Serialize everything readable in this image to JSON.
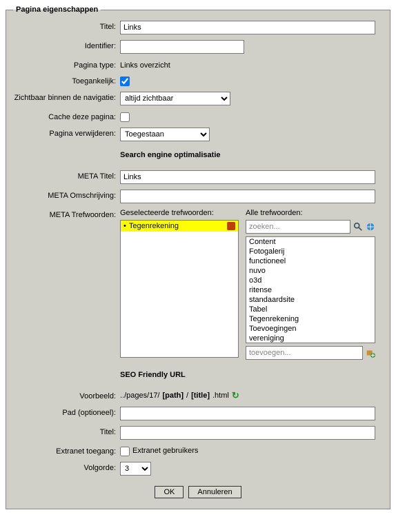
{
  "legend": "Pagina eigenschappen",
  "labels": {
    "titel": "Titel:",
    "identifier": "Identifier:",
    "pagina_type": "Pagina type:",
    "toegankelijk": "Toegankelijk:",
    "zichtbaar": "Zichtbaar binnen de navigatie:",
    "cache": "Cache deze pagina:",
    "verwijderen": "Pagina verwijderen:",
    "meta_titel": "META Titel:",
    "meta_omschrijving": "META Omschrijving:",
    "meta_trefwoorden": "META Trefwoorden:",
    "voorbeeld": "Voorbeeld:",
    "pad": "Pad (optioneel):",
    "titel2": "Titel:",
    "extranet": "Extranet toegang:",
    "volgorde": "Volgorde:"
  },
  "values": {
    "titel": "Links",
    "identifier": "",
    "pagina_type": "Links overzicht",
    "toegankelijk": true,
    "zichtbaar": "altijd zichtbaar",
    "cache": false,
    "verwijderen": "Toegestaan",
    "meta_titel": "Links",
    "meta_omschrijving": "",
    "pad": "",
    "titel2": "",
    "extranet": false,
    "volgorde": "3"
  },
  "sections": {
    "seo1": "Search engine optimalisatie",
    "seo2": "SEO Friendly URL"
  },
  "keywords": {
    "selected_label": "Geselecteerde trefwoorden:",
    "all_label": "Alle trefwoorden:",
    "selected": [
      "Tegenrekening"
    ],
    "all": [
      "Content",
      "Fotogalerij",
      "functioneel",
      "nuvo",
      "o3d",
      "ritense",
      "standaardsite",
      "Tabel",
      "Tegenrekening",
      "Toevoegingen",
      "vereniging"
    ],
    "search_placeholder": "zoeken...",
    "add_placeholder": "toevoegen..."
  },
  "url_example": {
    "prefix": "../pages/17/",
    "path": "[path]",
    "sep": "/",
    "title": "[title]",
    "suffix": ".html"
  },
  "extranet_label": "Extranet gebruikers",
  "buttons": {
    "ok": "OK",
    "cancel": "Annuleren"
  }
}
